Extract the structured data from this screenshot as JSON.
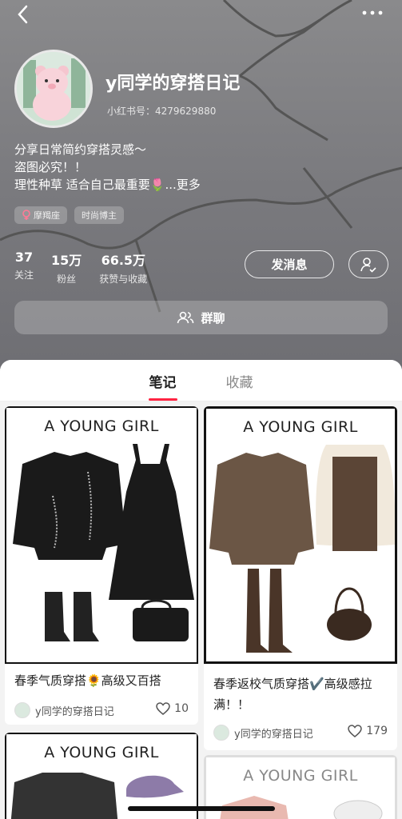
{
  "profile": {
    "name": "y同学的穿搭日记",
    "id_text": "小红书号：4279629880",
    "bio_lines": [
      "分享日常简约穿搭灵感～",
      "盗图必究！！",
      "理性种草 适合自己最重要🌷"
    ],
    "bio_more": "...更多",
    "tags": [
      {
        "label": "摩羯座",
        "icon": "female-icon"
      },
      {
        "label": "时尚博主",
        "icon": ""
      }
    ]
  },
  "stats": [
    {
      "num": "37",
      "label": "关注"
    },
    {
      "num": "15万",
      "label": "粉丝"
    },
    {
      "num": "66.5万",
      "label": "获赞与收藏"
    }
  ],
  "actions": {
    "message": "发消息",
    "group_chat": "群聊"
  },
  "tabs": [
    {
      "label": "笔记",
      "active": true
    },
    {
      "label": "收藏",
      "active": false
    }
  ],
  "notes": [
    {
      "poster_title": "A YOUNG GIRL",
      "title": "春季气质穿搭🌻高级又百搭",
      "author": "y同学的穿搭日记",
      "likes": "10"
    },
    {
      "poster_title": "A YOUNG GIRL",
      "title": "春季返校气质穿搭✔️高级感拉满！！",
      "author": "y同学的穿搭日记",
      "likes": "179"
    },
    {
      "poster_title": "A YOUNG GIRL"
    },
    {
      "poster_title": "A YOUNG GIRL"
    }
  ],
  "colors": {
    "accent": "#ff2442",
    "header_bg": "#7a7a7e"
  }
}
